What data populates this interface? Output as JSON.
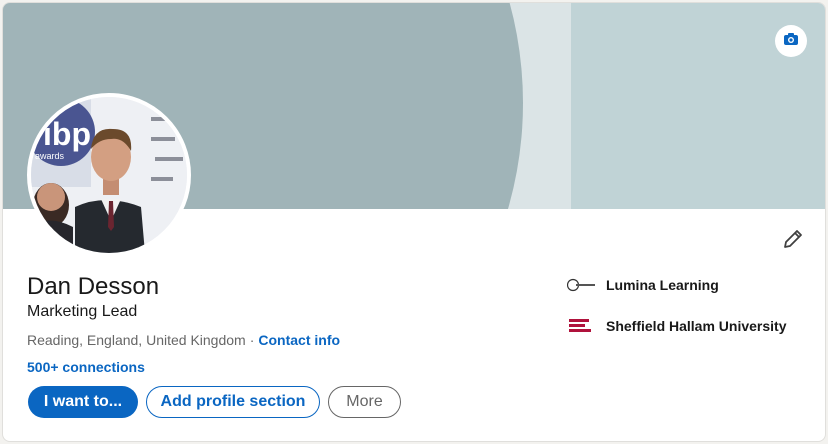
{
  "profile": {
    "name": "Dan Desson",
    "headline": "Marketing Lead",
    "location": "Reading, England, United Kingdom",
    "separator": "·",
    "contact_info_label": "Contact info",
    "connections": "500+ connections"
  },
  "actions": {
    "primary_label": "I want to...",
    "add_section_label": "Add profile section",
    "more_label": "More"
  },
  "experience": [
    {
      "name": "Lumina Learning",
      "logo": "lumina-logo"
    },
    {
      "name": "Sheffield Hallam University",
      "logo": "sheffield-hallam-logo"
    }
  ],
  "avatar_logo_text": "ibp",
  "avatar_logo_subtext": "awards",
  "icons": {
    "camera": "camera-icon",
    "edit": "pencil-icon"
  },
  "colors": {
    "accent": "#0a66c2",
    "banner_dark": "#a0b4b8",
    "banner_light": "#dbe4e6",
    "banner_right": "#c0d3d6"
  }
}
